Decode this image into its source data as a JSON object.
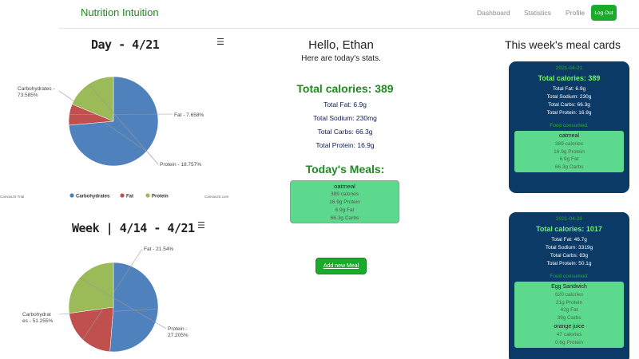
{
  "navbar": {
    "brand": "Nutrition Intuition",
    "links": {
      "dashboard": "Dashboard",
      "statistics": "Statistics",
      "profile": "Profile"
    },
    "logout_label": "Log Out"
  },
  "charts": {
    "menu_icon": "hamburger-menu-icon",
    "day_title": "Day - 4/21",
    "week_title": "Week | 4/14 - 4/21",
    "footer_left": "CanvasJS Trial",
    "footer_right": "CanvasJS.com"
  },
  "chart_data": [
    {
      "type": "pie",
      "title": "Day - 4/21",
      "slices": [
        {
          "label": "Carbohydrates",
          "value": 73.585,
          "text": "Carbohydrates - 73.585%",
          "color": "#4f81bc"
        },
        {
          "label": "Fat",
          "value": 7.658,
          "text": "Fat - 7.658%",
          "color": "#c0504e"
        },
        {
          "label": "Protein",
          "value": 18.757,
          "text": "Protein - 18.757%",
          "color": "#9bbb58"
        }
      ],
      "legend": [
        "Carbohydrates",
        "Fat",
        "Protein"
      ],
      "legend_placement": "bottom"
    },
    {
      "type": "pie",
      "title": "Week | 4/14 - 4/21",
      "slices": [
        {
          "label": "Carbohydrates",
          "value": 51.255,
          "text": "Carbohydrat es - 51.255%",
          "color": "#4f81bc"
        },
        {
          "label": "Fat",
          "value": 21.54,
          "text": "Fat - 21.54%",
          "color": "#c0504e"
        },
        {
          "label": "Protein",
          "value": 27.205,
          "text": "Protein - 27.205%",
          "color": "#9bbb58"
        }
      ]
    }
  ],
  "main": {
    "greeting": "Hello, Ethan",
    "subgreeting": "Here are today's stats.",
    "total_calories": "Total calories: 389",
    "fat": "Total Fat: 6.9g",
    "sodium": "Total Sodium: 230mg",
    "carbs": "Total Carbs: 66.3g",
    "protein": "Total Protein: 16.9g",
    "meals_heading": "Today's Meals:",
    "meal": {
      "name": "oatmeal",
      "calories": "389 calories",
      "protein": "16.9g Protein",
      "fat": "6.9g Fat",
      "carbs": "66.3g Carbs"
    },
    "add_meal_label": "Add new Meal"
  },
  "week_cards": {
    "heading": "This week's meal cards",
    "cards": [
      {
        "date": "2021-04-21",
        "total": "Total calories: 389",
        "fat": "Total Fat: 6.9g",
        "sodium": "Total Sodium: 230g",
        "carbs": "Total Carbs: 66.3g",
        "protein": "Total Protein: 16.9g",
        "food_label": "Food consumed:",
        "foods": [
          {
            "name": "oatmeal",
            "calories": "389 calories",
            "protein": "16.9g Protein",
            "fat": "6.9g Fat",
            "carbs": "66.3g Carbs"
          }
        ]
      },
      {
        "date": "2021-04-20",
        "total": "Total calories: 1017",
        "fat": "Total Fat: 46.7g",
        "sodium": "Total Sodium: 3319g",
        "carbs": "Total Carbs: 83g",
        "protein": "Total Protein: 50.1g",
        "food_label": "Food consumed:",
        "foods": [
          {
            "name": "Egg Sandwich",
            "calories": "620 calories",
            "protein": "21g Protein",
            "fat": "42g Fat",
            "carbs": "39g Carbs"
          },
          {
            "name": "orange juice",
            "calories": "47 calories",
            "protein": "0.6g Protein"
          }
        ]
      }
    ]
  },
  "colors": {
    "brand_green": "#1f8a1f",
    "button_green": "#1aab2a",
    "card_navy": "#0b3a66",
    "meal_green": "#5cd98c",
    "carbs_blue": "#4f81bc",
    "fat_red": "#c0504e",
    "protein_green": "#9bbb58"
  }
}
